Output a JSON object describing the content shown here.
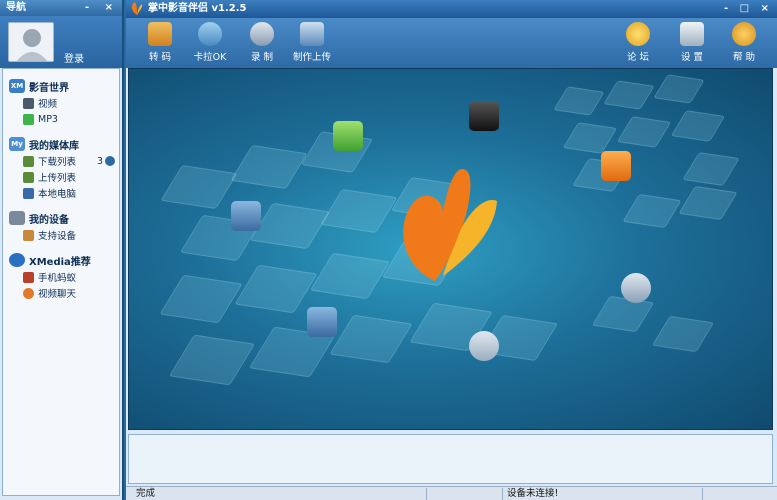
{
  "nav": {
    "title": "导航",
    "controls": "- ×",
    "login_label": "登录",
    "groups": [
      {
        "label": "影音世界",
        "icon": "xm-icon",
        "items": [
          {
            "label": "视频",
            "icon": "film-icon"
          },
          {
            "label": "MP3",
            "icon": "music-note-icon"
          }
        ]
      },
      {
        "label": "我的媒体库",
        "icon": "my-icon",
        "items": [
          {
            "label": "下载列表",
            "icon": "download-list-icon",
            "count": "3"
          },
          {
            "label": "上传列表",
            "icon": "upload-list-icon"
          },
          {
            "label": "本地电脑",
            "icon": "computer-icon"
          }
        ]
      },
      {
        "label": "我的设备",
        "icon": "device-icon",
        "items": [
          {
            "label": "支持设备",
            "icon": "supported-device-icon"
          }
        ]
      },
      {
        "label": "XMedia推荐",
        "icon": "xmedia-icon",
        "items": [
          {
            "label": "手机蚂蚁",
            "icon": "ant-icon"
          },
          {
            "label": "视频聊天",
            "icon": "video-chat-icon"
          }
        ]
      }
    ]
  },
  "app": {
    "title": "掌中影音伴侣 v1.2.5",
    "controls": "- □ ×"
  },
  "toolbar": {
    "left": [
      {
        "label": "转 码",
        "icon": "transcode-icon"
      },
      {
        "label": "卡拉OK",
        "icon": "karaoke-icon"
      },
      {
        "label": "录 制",
        "icon": "record-icon"
      },
      {
        "label": "制作上传",
        "icon": "make-upload-icon"
      }
    ],
    "right": [
      {
        "label": "论 坛",
        "icon": "forum-icon"
      },
      {
        "label": "设 置",
        "icon": "settings-icon"
      },
      {
        "label": "帮 助",
        "icon": "help-icon"
      }
    ]
  },
  "status": {
    "left": "完成",
    "middle": "设备未连接!"
  },
  "colors": {
    "nav_bg": "#dbe9f6",
    "title_bar": "#2f6aa4",
    "stage": "#1d6f99",
    "butterfly_orange": "#f07a1a",
    "butterfly_yellow": "#f6b42a"
  }
}
